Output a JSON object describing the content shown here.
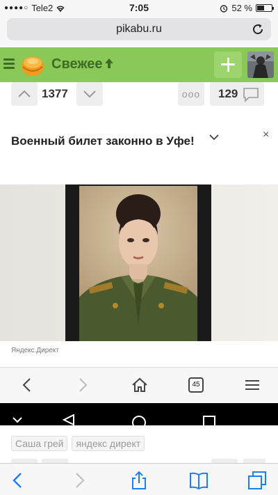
{
  "status_bar": {
    "carrier": "Tele2",
    "time": "7:05",
    "battery": "52 %",
    "battery_level": 0.52
  },
  "browser": {
    "url": "pikabu.ru"
  },
  "header": {
    "title": "Свежее"
  },
  "post": {
    "rating": "1377",
    "comments_count": "129",
    "more_label": "ooo"
  },
  "ad": {
    "title": "Военный билет законно в Уфе!",
    "close_label": "×",
    "source": "Яндекс.Директ"
  },
  "embedded_browser": {
    "tabs_count": "45"
  },
  "tags": [
    "Саша грей",
    "яндекс директ"
  ],
  "colors": {
    "header_bg": "#8ac858",
    "header_text": "#3d6b24",
    "ios_blue": "#1a7efb"
  }
}
